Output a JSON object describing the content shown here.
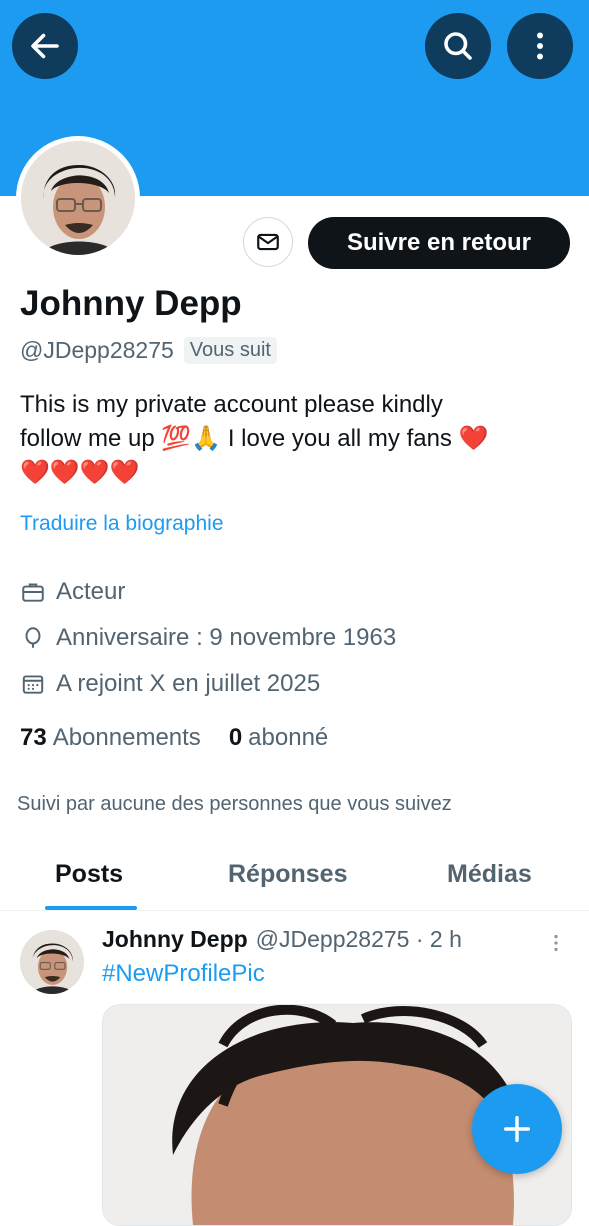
{
  "profile": {
    "name": "Johnny Depp",
    "handle": "@JDepp28275",
    "follows_you": "Vous suit",
    "bio_line1": "This is my private account please kindly",
    "bio_line2": "follow me up 💯🙏 I love you all my fans ❤️",
    "bio_line3": "❤️❤️❤️❤️",
    "translate_bio": "Traduire la biographie",
    "profession": "Acteur",
    "birthday": "Anniversaire : 9 novembre 1963",
    "joined": "A rejoint X en juillet 2025",
    "following_count": "73",
    "following_label": "Abonnements",
    "followers_count": "0",
    "followers_label": "abonné",
    "followed_by": "Suivi par aucune des personnes que vous suivez"
  },
  "actions": {
    "follow_back": "Suivre en retour"
  },
  "tabs": [
    {
      "label": "Posts",
      "active": true
    },
    {
      "label": "Réponses",
      "active": false
    },
    {
      "label": "Médias",
      "active": false
    }
  ],
  "post": {
    "author": "Johnny Depp",
    "handle_time": "@JDepp28275 · 2 h",
    "text": "#NewProfilePic"
  },
  "icons": {
    "back": "arrow-left-icon",
    "search": "search-icon",
    "more": "more-vertical-icon",
    "message": "envelope-icon",
    "profession": "briefcase-icon",
    "birthday": "balloon-icon",
    "joined": "calendar-icon",
    "compose": "plus-icon"
  },
  "colors": {
    "accent": "#1d9bf0",
    "banner": "#1d9bf0",
    "button_dark": "#0f1419"
  }
}
